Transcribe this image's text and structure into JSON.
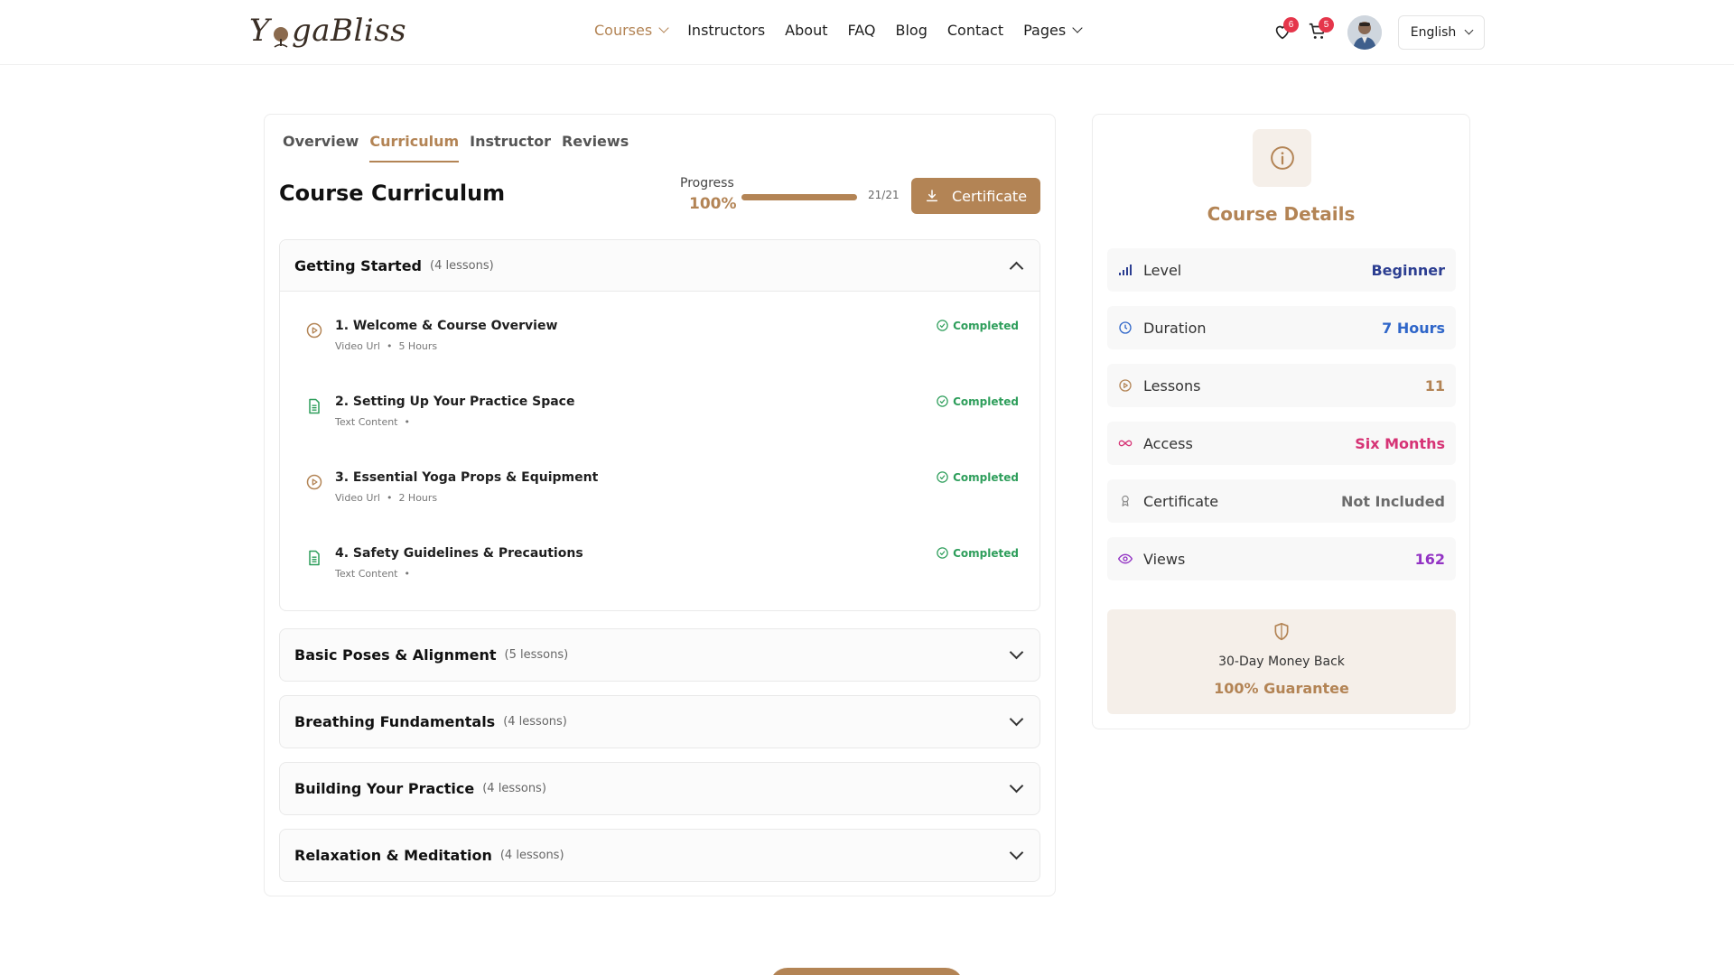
{
  "header": {
    "logo_left": "Y",
    "logo_right": "gaBliss",
    "nav": [
      {
        "label": "Courses",
        "active": true,
        "dropdown": true
      },
      {
        "label": "Instructors",
        "active": false,
        "dropdown": false
      },
      {
        "label": "About",
        "active": false,
        "dropdown": false
      },
      {
        "label": "FAQ",
        "active": false,
        "dropdown": false
      },
      {
        "label": "Blog",
        "active": false,
        "dropdown": false
      },
      {
        "label": "Contact",
        "active": false,
        "dropdown": false
      },
      {
        "label": "Pages",
        "active": false,
        "dropdown": true
      }
    ],
    "wishlist_count": "6",
    "cart_count": "5",
    "language": "English"
  },
  "tabs": [
    "Overview",
    "Curriculum",
    "Instructor",
    "Reviews"
  ],
  "active_tab": "Curriculum",
  "curriculum": {
    "title": "Course Curriculum",
    "progress_label": "Progress",
    "progress_percent": "100%",
    "progress_value": 1.0,
    "progress_count": "21/21",
    "certificate_button": "Certificate"
  },
  "sections": [
    {
      "title": "Getting Started",
      "count": "(4 lessons)",
      "open": true,
      "lessons": [
        {
          "title": "1. Welcome & Course Overview",
          "type": "Video Url",
          "duration": "5 Hours",
          "status": "Completed",
          "icon": "play-circle-icon"
        },
        {
          "title": "2. Setting Up Your Practice Space",
          "type": "Text Content",
          "duration": "",
          "status": "Completed",
          "icon": "document-icon"
        },
        {
          "title": "3. Essential Yoga Props & Equipment",
          "type": "Video Url",
          "duration": "2 Hours",
          "status": "Completed",
          "icon": "play-circle-icon"
        },
        {
          "title": "4. Safety Guidelines & Precautions",
          "type": "Text Content",
          "duration": "",
          "status": "Completed",
          "icon": "document-icon"
        }
      ]
    },
    {
      "title": "Basic Poses & Alignment",
      "count": "(5 lessons)",
      "open": false
    },
    {
      "title": "Breathing Fundamentals",
      "count": "(4 lessons)",
      "open": false
    },
    {
      "title": "Building Your Practice",
      "count": "(4 lessons)",
      "open": false
    },
    {
      "title": "Relaxation & Meditation",
      "count": "(4 lessons)",
      "open": false
    }
  ],
  "course_details": {
    "title": "Course Details",
    "rows": [
      {
        "label": "Level",
        "value": "Beginner",
        "color": "#2c3e91",
        "icon": "signal-bars-icon"
      },
      {
        "label": "Duration",
        "value": "7 Hours",
        "color": "#2f66c9",
        "icon": "clock-icon"
      },
      {
        "label": "Lessons",
        "value": "11",
        "color": "#b38455",
        "icon": "play-circle-icon"
      },
      {
        "label": "Access",
        "value": "Six Months",
        "color": "#d63375",
        "icon": "infinity-icon"
      },
      {
        "label": "Certificate",
        "value": "Not Included",
        "color": "#6b6b6b",
        "icon": "award-icon"
      },
      {
        "label": "Views",
        "value": "162",
        "color": "#9334c4",
        "icon": "eye-icon"
      }
    ],
    "guarantee_line1": "30-Day Money Back",
    "guarantee_line2": "100% Guarantee"
  },
  "colors": {
    "accent": "#b38455",
    "completed": "#2e9e5b",
    "badge": "#e5364b"
  }
}
